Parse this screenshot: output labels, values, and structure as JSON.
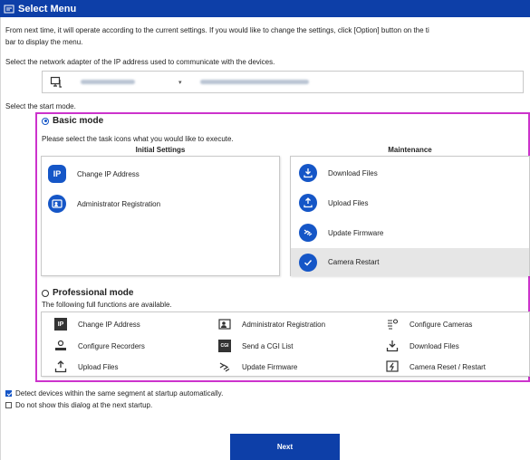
{
  "window": {
    "title": "Select Menu"
  },
  "intro_text_1": "From next time, it will operate according to the current settings. If you would like to change the settings, click [Option] button on the ti",
  "intro_text_2": "bar to display the menu.",
  "adapter": {
    "label": "Select the network adapter of the IP address used to communicate with the devices.",
    "selected_ip": "192.168.77.212",
    "selected_nic": "Intel(R) Ethernet Connection (4) I219-LM"
  },
  "start_mode_label": "Select the start mode.",
  "basic_mode": {
    "label": "Basic mode",
    "selected": true,
    "instruction": "Please select the task icons what you would like to execute.",
    "initial_settings": {
      "heading": "Initial Settings",
      "items": [
        {
          "label": "Change IP Address",
          "icon": "ip-icon"
        },
        {
          "label": "Administrator Registration",
          "icon": "admin-icon"
        }
      ]
    },
    "maintenance": {
      "heading": "Maintenance",
      "items": [
        {
          "label": "Download Files",
          "icon": "download-icon"
        },
        {
          "label": "Upload Files",
          "icon": "upload-icon"
        },
        {
          "label": "Update Firmware",
          "icon": "firmware-icon"
        },
        {
          "label": "Camera Restart",
          "icon": "check-icon",
          "selected": true
        }
      ]
    }
  },
  "professional_mode": {
    "label": "Professional mode",
    "selected": false,
    "instruction": "The following full functions are available.",
    "functions": [
      {
        "label": "Change IP Address",
        "icon": "ip-icon"
      },
      {
        "label": "Administrator Registration",
        "icon": "admin-icon"
      },
      {
        "label": "Configure Cameras",
        "icon": "camera-config-icon"
      },
      {
        "label": "Configure Recorders",
        "icon": "recorder-config-icon"
      },
      {
        "label": "Send a CGI List",
        "icon": "cgi-icon"
      },
      {
        "label": "Download Files",
        "icon": "download-icon"
      },
      {
        "label": "Upload Files",
        "icon": "upload-icon"
      },
      {
        "label": "Update Firmware",
        "icon": "firmware-icon"
      },
      {
        "label": "Camera Reset / Restart",
        "icon": "reset-icon"
      }
    ]
  },
  "options": {
    "detect_devices": {
      "label": "Detect devices within the same segment at startup automatically.",
      "checked": true
    },
    "do_not_show": {
      "label": "Do not show this dialog at the next startup.",
      "checked": false
    }
  },
  "next_label": "Next",
  "colors": {
    "accent": "#0d3fa8",
    "icon_blue": "#1556c7",
    "highlight_border": "#cc33cc",
    "selected_bg": "#e6e6e6"
  }
}
